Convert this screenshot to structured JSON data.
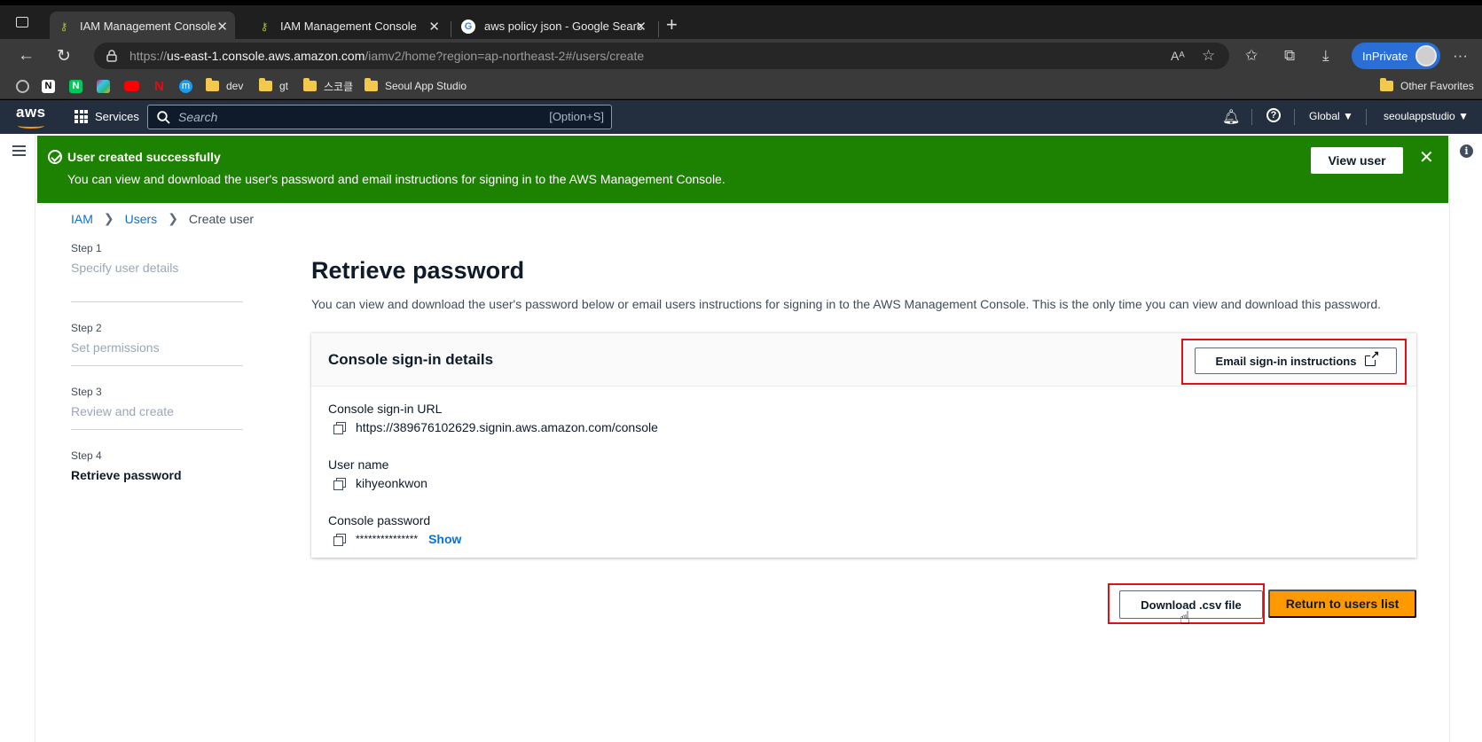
{
  "browser": {
    "tabs": [
      {
        "title": "IAM Management Console",
        "active": true
      },
      {
        "title": "IAM Management Console",
        "active": false
      },
      {
        "title": "aws policy json - Google Searc",
        "active": false
      }
    ],
    "url": {
      "prefix": "https://",
      "host": "us-east-1.console.aws.amazon.com",
      "path": "/iamv2/home?region=ap-northeast-2#/users/create"
    },
    "inprivate_label": "InPrivate",
    "favorites": {
      "folders": [
        "dev",
        "gt",
        "스코클",
        "Seoul App Studio"
      ],
      "other": "Other Favorites"
    }
  },
  "aws_header": {
    "logo": "aws",
    "services_label": "Services",
    "search_placeholder": "Search",
    "search_shortcut": "[Option+S]",
    "region": "Global ▼",
    "account": "seoulappstudio ▼"
  },
  "flash": {
    "title": "User created successfully",
    "message": "You can view and download the user's password and email instructions for signing in to the AWS Management Console.",
    "action": "View user"
  },
  "breadcrumb": {
    "items": [
      "IAM",
      "Users",
      "Create user"
    ]
  },
  "steps": [
    {
      "label": "Step 1",
      "name": "Specify user details"
    },
    {
      "label": "Step 2",
      "name": "Set permissions"
    },
    {
      "label": "Step 3",
      "name": "Review and create"
    },
    {
      "label": "Step 4",
      "name": "Retrieve password"
    }
  ],
  "main": {
    "title": "Retrieve password",
    "description": "You can view and download the user's password below or email users instructions for signing in to the AWS Management Console. This is the only time you can view and download this password.",
    "card": {
      "title": "Console sign-in details",
      "email_button": "Email sign-in instructions",
      "url_label": "Console sign-in URL",
      "url_value": "https://389676102629.signin.aws.amazon.com/console",
      "username_label": "User name",
      "username_value": "kihyeonkwon",
      "password_label": "Console password",
      "password_value": "***************",
      "show_label": "Show"
    },
    "download_button": "Download .csv file",
    "return_button": "Return to users list"
  },
  "colors": {
    "success": "#1d8102",
    "aws_nav": "#232f3e",
    "primary": "#ff9900",
    "link": "#0972d3",
    "highlight": "#e0101a"
  }
}
